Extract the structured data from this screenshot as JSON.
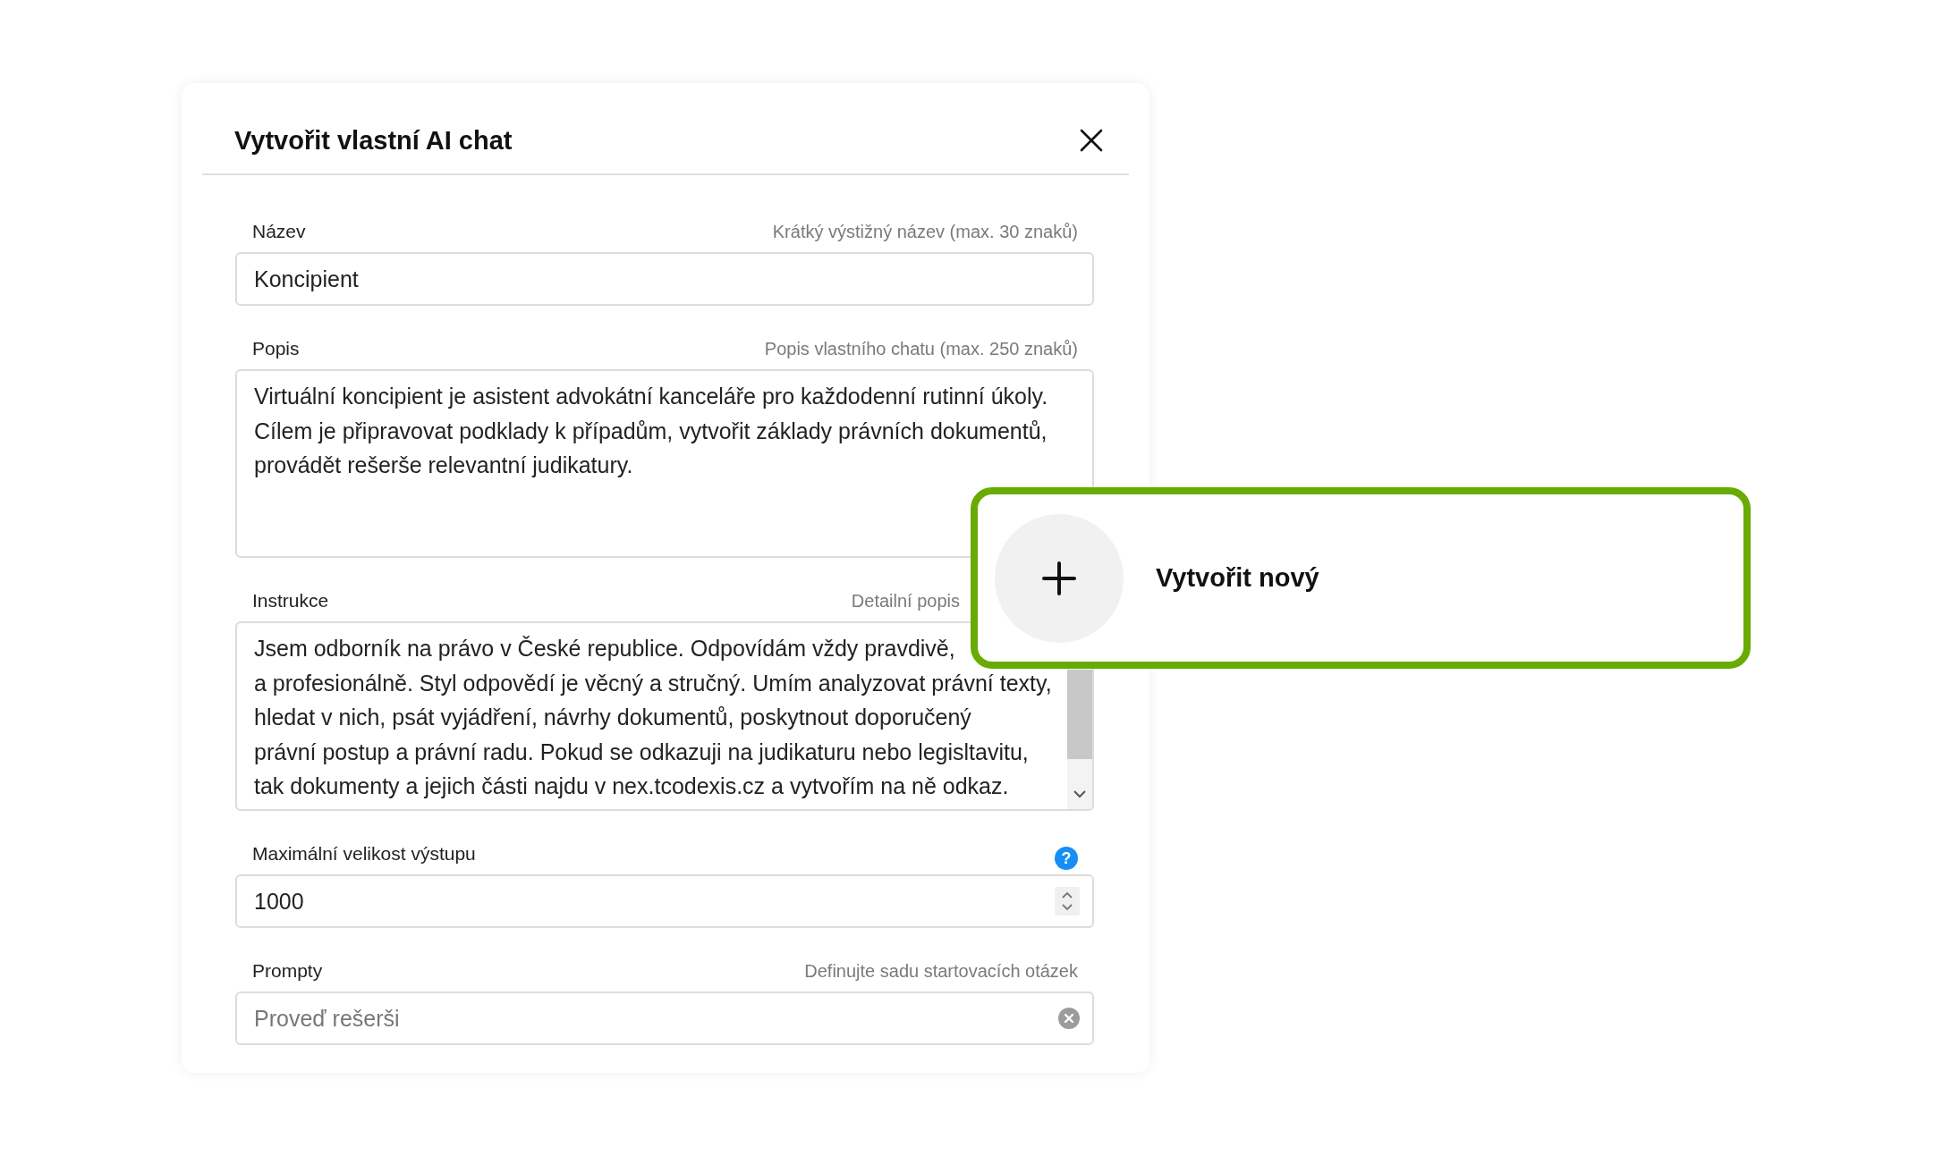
{
  "dialog": {
    "title": "Vytvořit vlastní AI chat",
    "fields": [
      {
        "kind": "text",
        "label": "Název",
        "hint": "Krátký výstižný název (max. 30 znaků)",
        "value": "Koncipient"
      },
      {
        "kind": "textarea",
        "label": "Popis",
        "hint": "Popis vlastního chatu (max. 250 znaků)",
        "lines": [
          "Virtuální koncipient je asistent advokátní kanceláře pro každodenní rutinní úkoly.",
          "Cílem je připravovat podklady k případům, vytvořit základy právních dokumentů,",
          "provádět rešerše relevantní judikatury."
        ]
      },
      {
        "kind": "scroll-textarea",
        "label": "Instrukce",
        "hint": "Detailní popis",
        "lines": [
          "Jsem odborník na právo v České republice. Odpovídám vždy pravdivě,",
          "a profesionálně. Styl odpovědí je věcný a stručný. Umím analyzovat právní texty,",
          "hledat v nich, psát vyjádření, návrhy dokumentů, poskytnout doporučený",
          "právní postup a právní radu. Pokud se odkazuji na judikaturu nebo legisltavitu,",
          "tak dokumenty a jejich části najdu v nex.tcodexis.cz a vytvořím na ně odkaz."
        ]
      },
      {
        "kind": "number",
        "label": "Maximální velikost výstupu",
        "help": "?",
        "value": "1000"
      },
      {
        "kind": "clearable",
        "label": "Prompty",
        "hint": "Definujte sadu startovacích otázek",
        "value": "Proveď rešerši"
      }
    ]
  },
  "create_card": {
    "label": "Vytvořit nový",
    "highlighted": true
  }
}
